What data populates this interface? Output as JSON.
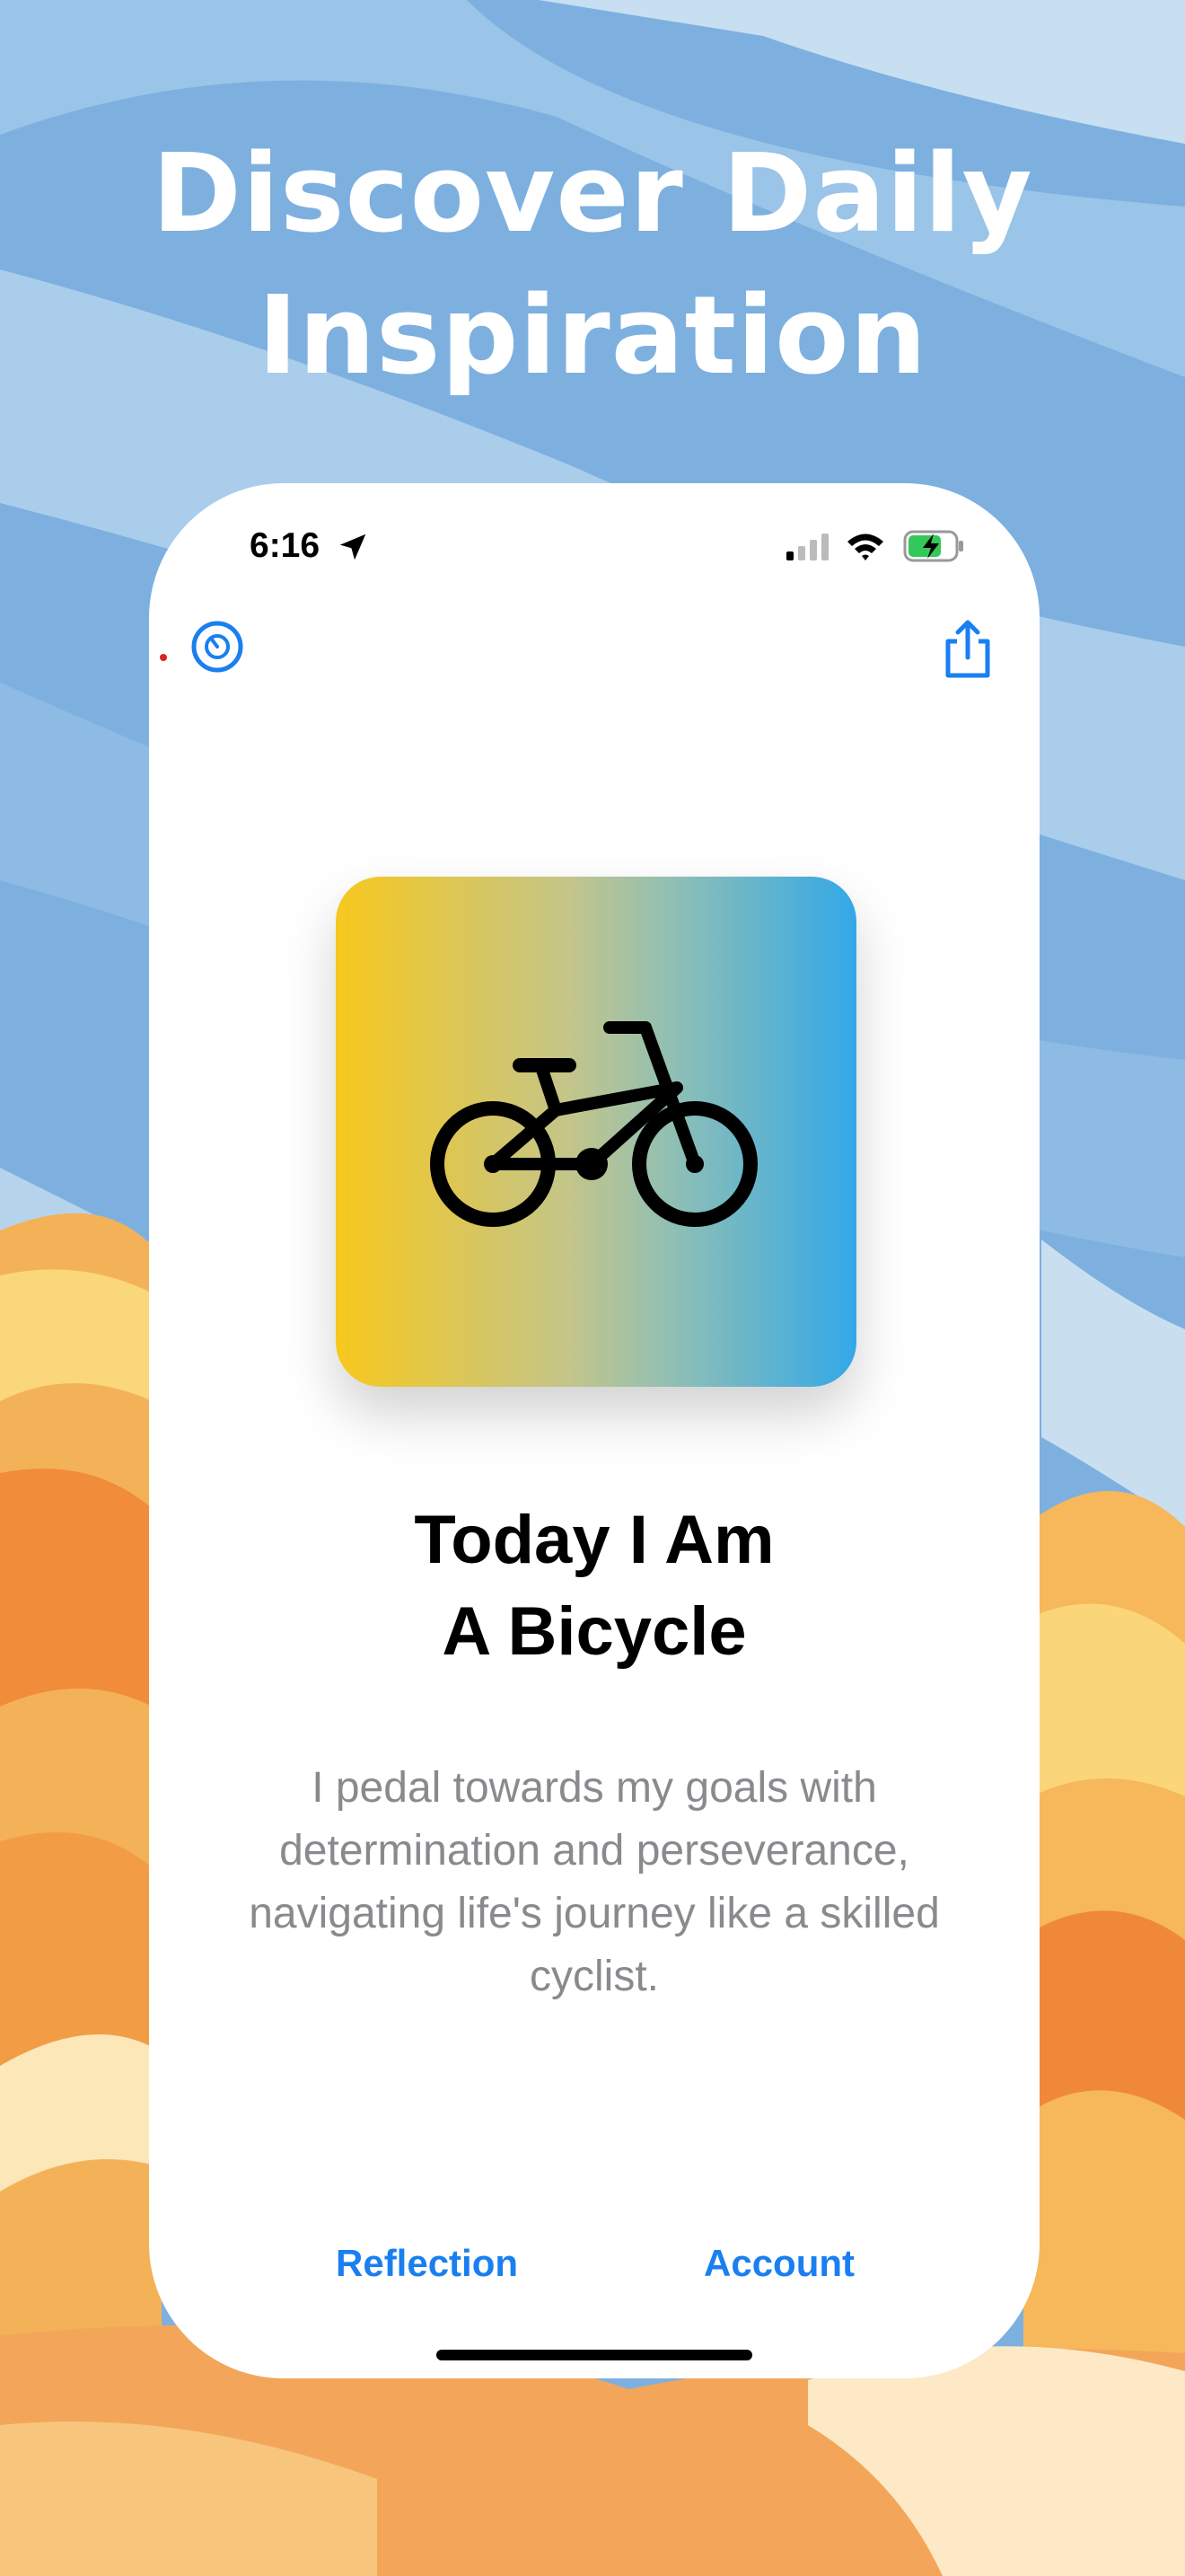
{
  "headline": {
    "line1": "Discover Daily",
    "line2": "Inspiration"
  },
  "status_bar": {
    "time": "6:16"
  },
  "card": {
    "icon": "bicycle-icon",
    "gradient": [
      "#f7c81e",
      "#c3c58a",
      "#8fbfb5",
      "#33a8e8"
    ]
  },
  "content": {
    "title_line1": "Today I Am",
    "title_line2": "A Bicycle",
    "description": "I pedal towards my goals with determination and perseverance, navigating life's journey like a skilled cyclist."
  },
  "tabs": {
    "reflection": "Reflection",
    "account": "Account"
  },
  "colors": {
    "accent": "#1a7ff0",
    "description_text": "#8a8a8e",
    "sky": "#7fb2e0",
    "sand": "#f3a24e"
  },
  "icons": {
    "timer": "timer-icon",
    "share": "share-icon",
    "location": "location-arrow-icon",
    "signal": "cellular-signal-icon",
    "wifi": "wifi-icon",
    "battery": "battery-charging-icon"
  }
}
